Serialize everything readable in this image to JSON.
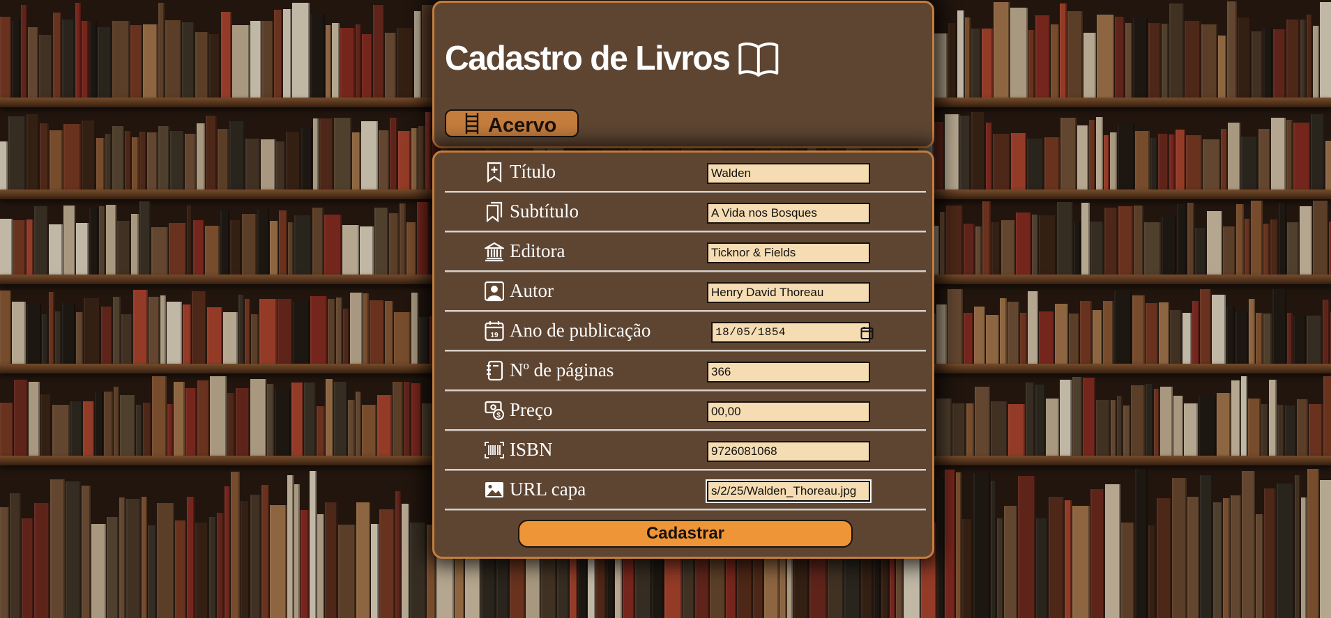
{
  "header": {
    "title": "Cadastro de Livros",
    "title_icon": "book-open-icon",
    "acervo_label": "Acervo",
    "acervo_icon": "ladder-icon"
  },
  "form": {
    "fields": [
      {
        "label": "Título",
        "icon": "bookmark-plus-icon",
        "value": "Walden"
      },
      {
        "label": "Subtítulo",
        "icon": "bookmarks-icon",
        "value": "A Vida nos Bosques"
      },
      {
        "label": "Editora",
        "icon": "bank-icon",
        "value": "Ticknor & Fields"
      },
      {
        "label": "Autor",
        "icon": "person-square-icon",
        "value": "Henry David Thoreau"
      },
      {
        "label": "Ano de publicação",
        "icon": "calendar-date-icon",
        "value": "18/05/1854"
      },
      {
        "label": "Nº de páginas",
        "icon": "journal-icon",
        "value": "366"
      },
      {
        "label": "Preço",
        "icon": "cash-coin-icon",
        "value": "00,00"
      },
      {
        "label": "ISBN",
        "icon": "barcode-icon",
        "value": "9726081068"
      },
      {
        "label": "URL capa",
        "icon": "image-icon",
        "value": "s/2/25/Walden_Thoreau.jpg"
      }
    ],
    "submit_label": "Cadastrar"
  },
  "colors": {
    "panel": "#5e4532",
    "panel_border": "#c57d3d",
    "acervo_button": "#c57d3d",
    "submit_button": "#ee9538",
    "input_bg": "#f5dcb2"
  }
}
